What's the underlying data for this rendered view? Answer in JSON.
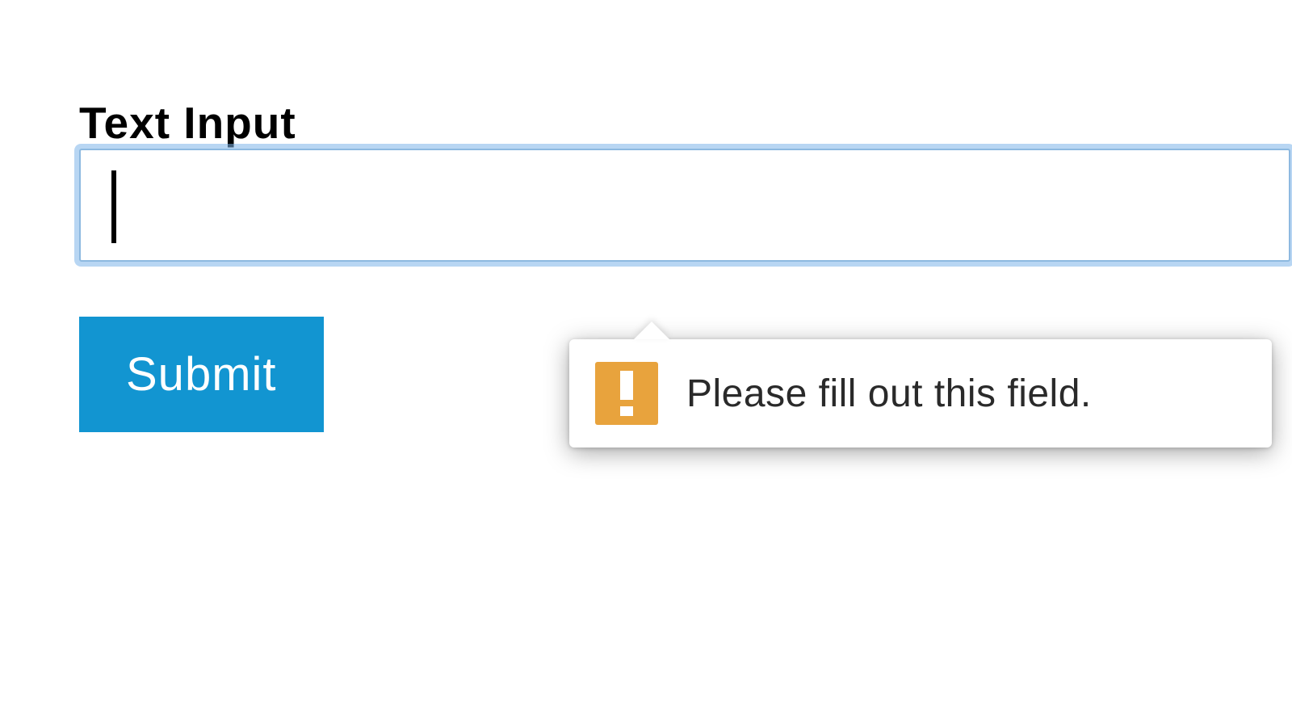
{
  "form": {
    "label": "Text Input",
    "input_value": "",
    "submit_label": "Submit"
  },
  "validation": {
    "message": "Please fill out this field.",
    "icon_name": "warning-icon"
  },
  "colors": {
    "focus_ring": "#8db9e0",
    "submit_bg": "#1295d1",
    "warning_icon_bg": "#e8a33d"
  }
}
